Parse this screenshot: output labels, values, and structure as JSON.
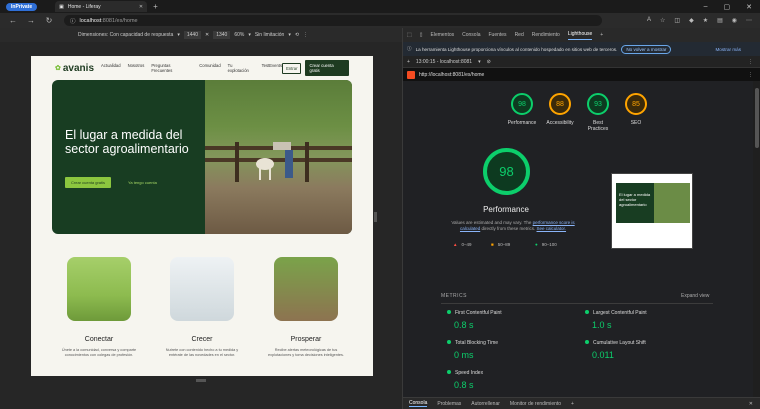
{
  "browser": {
    "inprivate": "InPrivate",
    "tab_title": "Home - Liferay",
    "url_host": "localhost",
    "url_path": ":8081/es/home"
  },
  "device_toolbar": {
    "dimensions": "Dimensiones: Con capacidad de respuesta",
    "width": "1440",
    "height": "1340",
    "zoom": "60%",
    "throttle": "Sin limitación"
  },
  "site": {
    "logo": "avanis",
    "menu": [
      "Actualidad",
      "Nosotros",
      "Preguntas Frecuentes",
      "Comunidad",
      "Tu explotación",
      "TestEvents"
    ],
    "enter": "Entrar",
    "create": "Crear cuenta gratis",
    "hero_title": "El lugar a medida del sector agroalimentario",
    "hero_primary": "Crear cuenta gratis",
    "hero_secondary": "Ya tengo cuenta",
    "features": [
      {
        "title": "Conectar",
        "text": "Únete a la comunidad, conversa y comparte conocimientos con colegas de profesión."
      },
      {
        "title": "Crecer",
        "text": "Nutrete con contenido hecho a tu medida y entérate de las novedades en el sector."
      },
      {
        "title": "Prosperar",
        "text": "Recibe alertas meteorológicas de tus explotaciones y toma decisiones inteligentes."
      }
    ]
  },
  "devtools": {
    "tabs": [
      "Elementos",
      "Consola",
      "Fuentes",
      "Red",
      "Rendimiento",
      "Lighthouse"
    ],
    "notice": "La herramienta Lighthouse proporciona vínculos al contenido hospedado en sitios web de terceros.",
    "notice_btn": "No volver a mostrar",
    "notice_more": "Mostrar más",
    "report_time": "13:00:15 - localhost:8081",
    "report_url": "http://localhost:8081/es/home",
    "scores": [
      {
        "label": "Performance",
        "value": "98",
        "color": "green"
      },
      {
        "label": "Accessibility",
        "value": "88",
        "color": "orange"
      },
      {
        "label": "Best Practices",
        "value": "93",
        "color": "green"
      },
      {
        "label": "SEO",
        "value": "85",
        "color": "orange"
      }
    ],
    "perf_score": "98",
    "perf_title": "Performance",
    "vary_a": "Values are estimated and may vary. The ",
    "vary_link1": "performance score is calculated",
    "vary_b": " directly from these metrics. ",
    "vary_link2": "See calculator.",
    "legend": [
      {
        "range": "0–49",
        "symbol": "▲",
        "color": "#ff4e42"
      },
      {
        "range": "50–89",
        "symbol": "■",
        "color": "#ffa400"
      },
      {
        "range": "90–100",
        "symbol": "●",
        "color": "#0cce6b"
      }
    ],
    "thumb_text": "El lugar a medida del sector agroalimentario",
    "metrics_label": "METRICS",
    "expand": "Expand view",
    "metrics": [
      {
        "name": "First Contentful Paint",
        "value": "0.8 s"
      },
      {
        "name": "Largest Contentful Paint",
        "value": "1.0 s"
      },
      {
        "name": "Total Blocking Time",
        "value": "0 ms"
      },
      {
        "name": "Cumulative Layout Shift",
        "value": "0.011"
      },
      {
        "name": "Speed Index",
        "value": "0.8 s"
      }
    ],
    "drawer": [
      "Consola",
      "Problemas",
      "Autorrellenar",
      "Monitor de rendimiento"
    ]
  }
}
